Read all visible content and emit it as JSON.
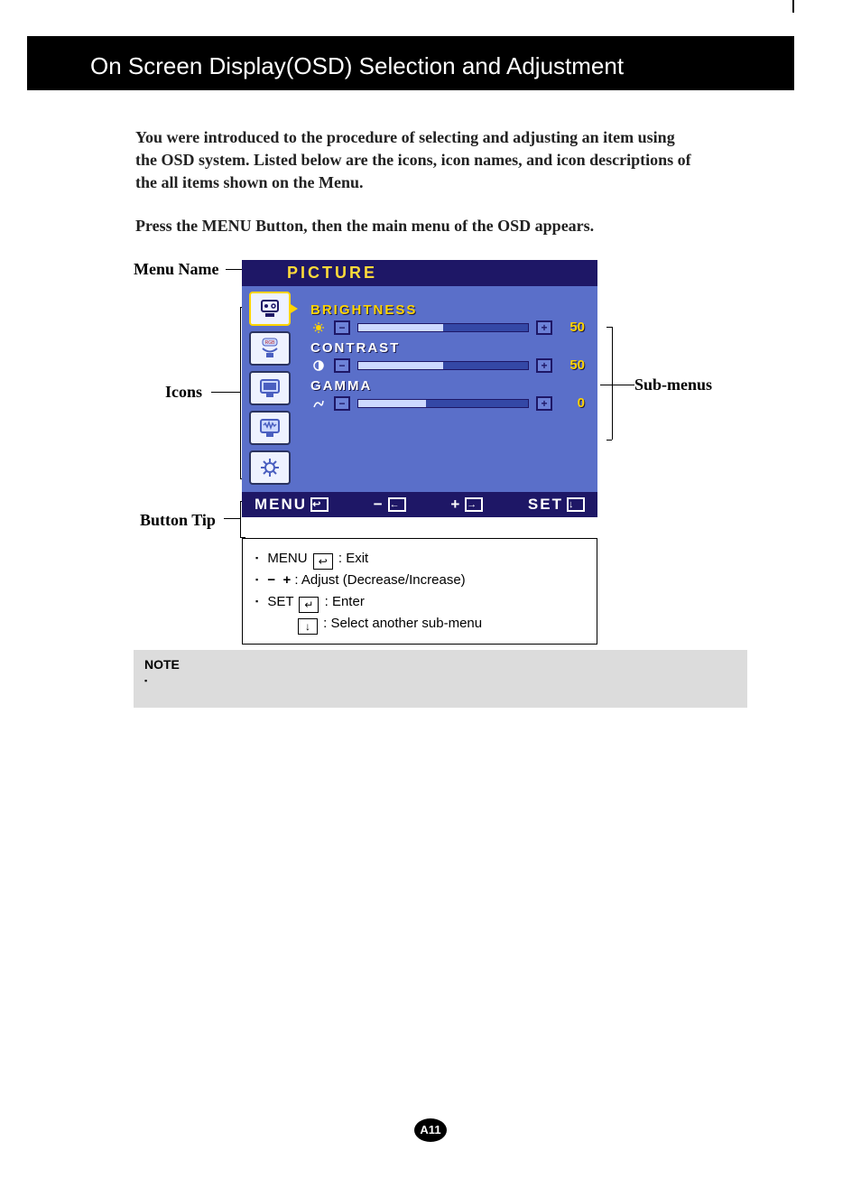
{
  "header": {
    "title": "On Screen Display(OSD) Selection and Adjustment"
  },
  "intro": {
    "p1": "You were introduced to the procedure of selecting and adjusting an item using the OSD system.  Listed below are the icons, icon names, and icon descriptions of the all items shown on the Menu.",
    "p2": "Press the MENU Button, then the main menu of the OSD appears."
  },
  "callouts": {
    "menuName": "Menu Name",
    "icons": "Icons",
    "buttonTip": "Button Tip",
    "subMenus": "Sub-menus"
  },
  "osd": {
    "title": "PICTURE",
    "items": [
      {
        "label": "BRIGHTNESS",
        "value": "50",
        "hi": true,
        "fill": 50
      },
      {
        "label": "CONTRAST",
        "value": "50",
        "hi": false,
        "fill": 50
      },
      {
        "label": "GAMMA",
        "value": "0",
        "hi": false,
        "fill": 40
      }
    ],
    "footer": {
      "menu": "MENU",
      "minus": "−",
      "plus": "+",
      "set": "SET"
    }
  },
  "tips": {
    "t1a": "MENU",
    "t1b": " : Exit",
    "t2": " : Adjust (Decrease/Increase)",
    "t3a": "SET",
    "t3b": " : Enter",
    "t4": " : Select another sub-menu"
  },
  "note": {
    "title": "NOTE"
  },
  "page": "A11"
}
